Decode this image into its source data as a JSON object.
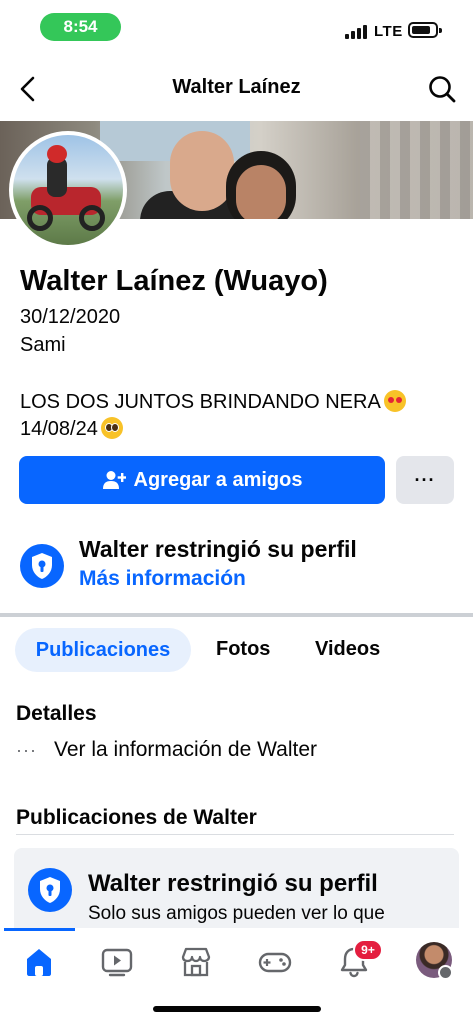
{
  "status_bar": {
    "time": "8:54",
    "network": "LTE"
  },
  "header": {
    "title": "Walter Laínez"
  },
  "profile": {
    "name": "Walter Laínez (Wuayo)",
    "line1": "30/12/2020",
    "line2": "Sami",
    "bio_line1": "LOS DOS JUNTOS BRINDANDO NERA",
    "bio_line2": "14/08/24"
  },
  "actions": {
    "add_friend_label": "Agregar a amigos",
    "more_label": "···"
  },
  "restriction": {
    "title": "Walter restringió su perfil",
    "link": "Más información"
  },
  "tabs": [
    {
      "label": "Publicaciones",
      "active": true
    },
    {
      "label": "Fotos",
      "active": false
    },
    {
      "label": "Videos",
      "active": false
    }
  ],
  "details": {
    "title": "Detalles",
    "item": "Ver la información de Walter"
  },
  "posts": {
    "title": "Publicaciones de Walter",
    "card_title": "Walter restringió su perfil",
    "card_text": "Solo sus amigos pueden ver lo que"
  },
  "bottom_nav": {
    "items": [
      "home-icon",
      "video-icon",
      "marketplace-icon",
      "gaming-icon",
      "notifications-icon",
      "profile-menu"
    ],
    "notification_badge": "9+"
  },
  "colors": {
    "accent": "#0866ff",
    "badge": "#e41e3f",
    "status_pill": "#34c759"
  }
}
